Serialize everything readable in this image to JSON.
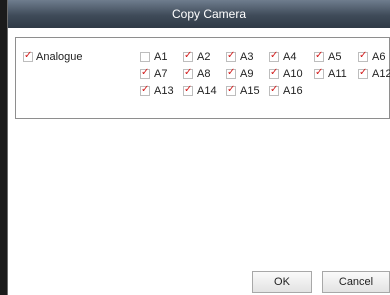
{
  "dialog": {
    "title": "Copy Camera"
  },
  "group": {
    "label": "Analogue",
    "checked": true
  },
  "cameras": [
    {
      "label": "A1",
      "checked": false
    },
    {
      "label": "A2",
      "checked": true
    },
    {
      "label": "A3",
      "checked": true
    },
    {
      "label": "A4",
      "checked": true
    },
    {
      "label": "A5",
      "checked": true
    },
    {
      "label": "A6",
      "checked": true
    },
    {
      "label": "A7",
      "checked": true
    },
    {
      "label": "A8",
      "checked": true
    },
    {
      "label": "A9",
      "checked": true
    },
    {
      "label": "A10",
      "checked": true
    },
    {
      "label": "A11",
      "checked": true
    },
    {
      "label": "A12",
      "checked": true
    },
    {
      "label": "A13",
      "checked": true
    },
    {
      "label": "A14",
      "checked": true
    },
    {
      "label": "A15",
      "checked": true
    },
    {
      "label": "A16",
      "checked": true
    }
  ],
  "buttons": {
    "ok": "OK",
    "cancel": "Cancel"
  },
  "colors": {
    "check_mark": "#d21c1c",
    "title_bar": "#3f4b59"
  }
}
